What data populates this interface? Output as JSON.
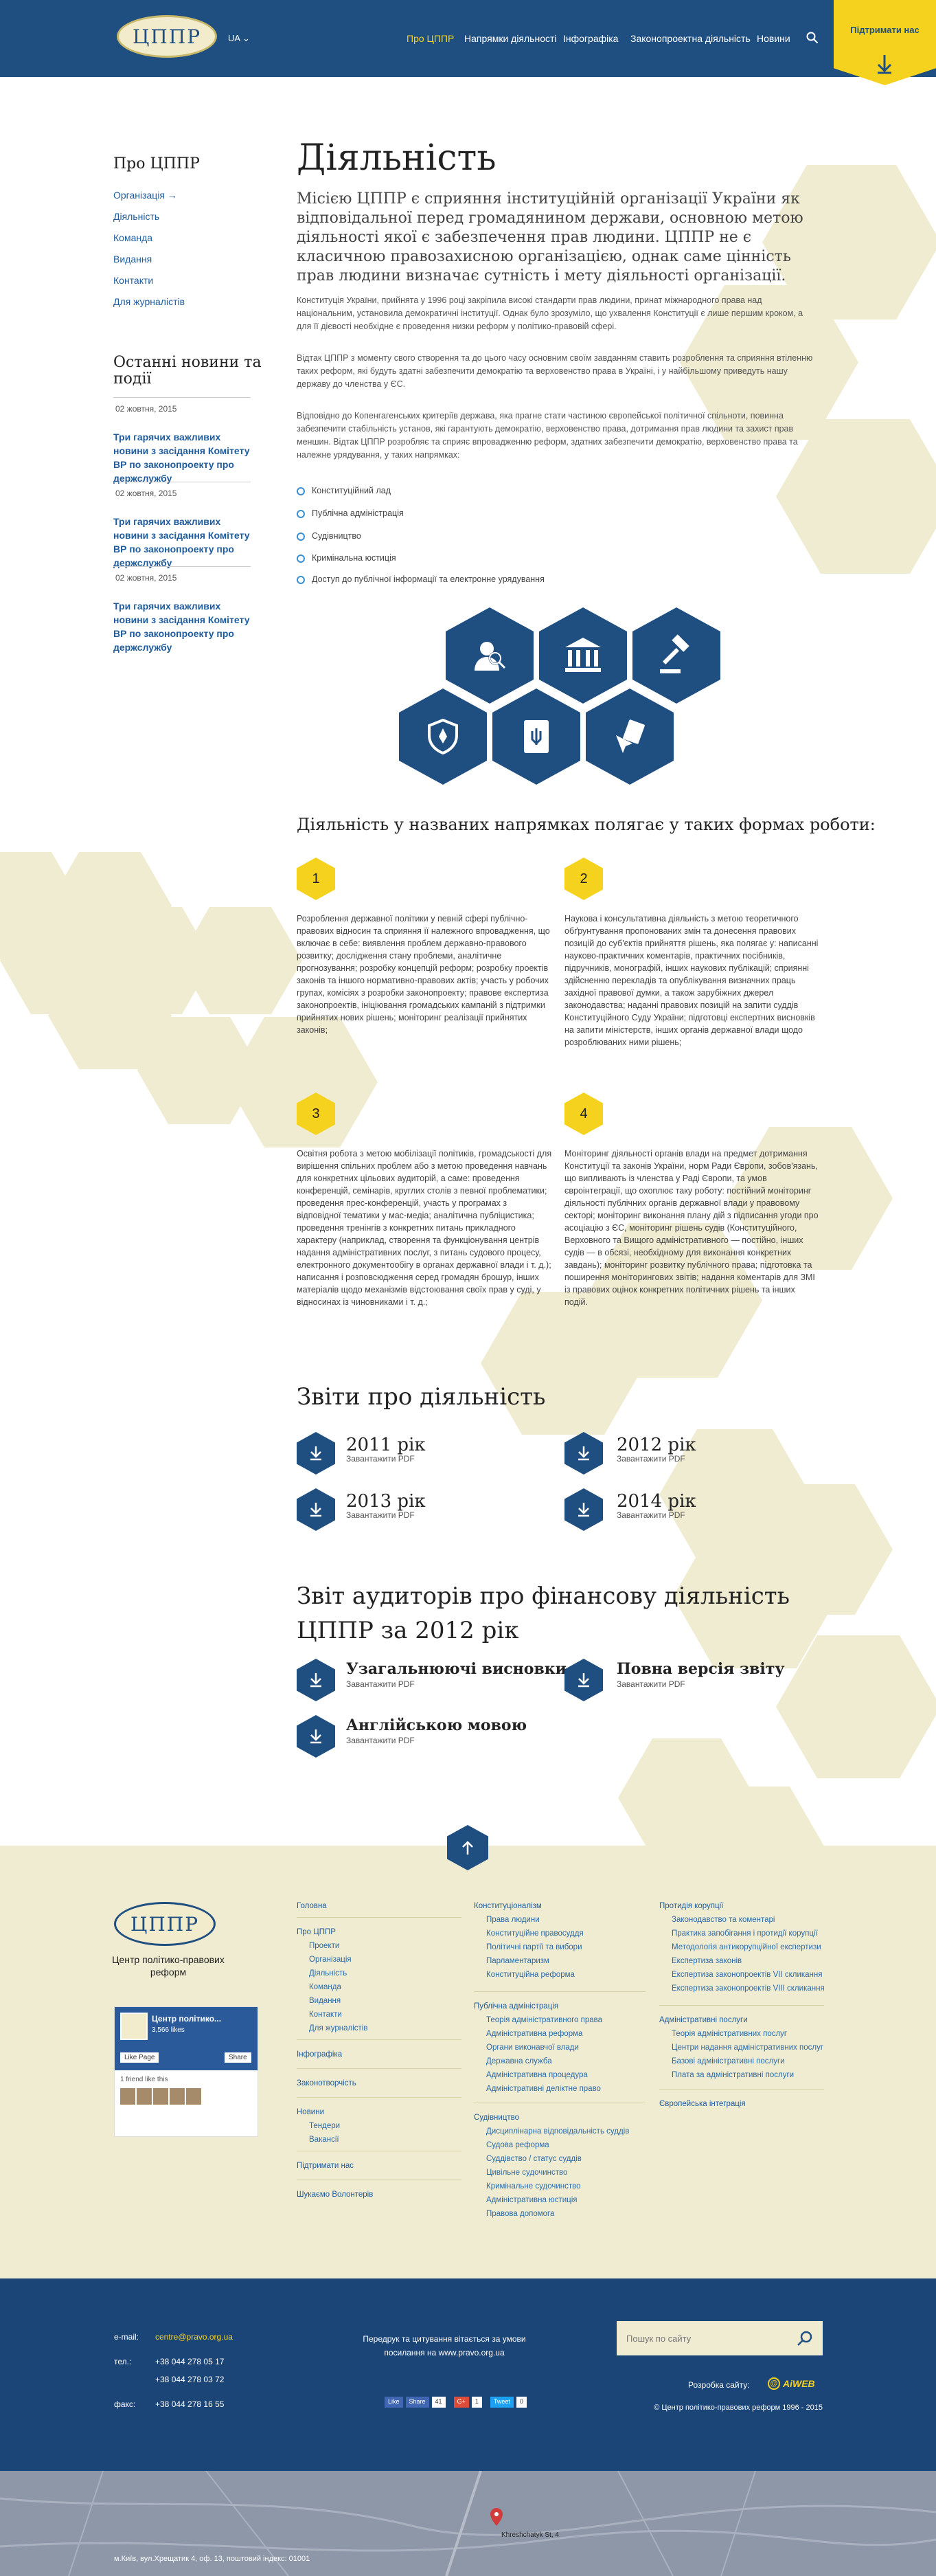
{
  "header": {
    "logo": "ЦППР",
    "lang": "UA",
    "nav": [
      "Про ЦППР",
      "Напрямки діяльності",
      "Інфографіка",
      "Законопроектна діяльність",
      "Новини"
    ],
    "support": "Підтримати нас"
  },
  "sidebar": {
    "title": "Про ЦППР",
    "links": [
      "Організація",
      "Діяльність",
      "Команда",
      "Видання",
      "Контакти",
      "Для журналістів"
    ],
    "news_title": "Останні новини та події",
    "news": [
      {
        "date": "02 жовтня, 2015",
        "title": "Три гарячих важливих новини з засідання Комітету ВР по законопроекту про держслужбу"
      },
      {
        "date": "02 жовтня, 2015",
        "title": "Три гарячих важливих новини з засідання Комітету ВР по законопроекту про держслужбу"
      },
      {
        "date": "02 жовтня, 2015",
        "title": "Три гарячих важливих новини з засідання Комітету ВР по законопроекту про держслужбу"
      }
    ]
  },
  "main": {
    "title": "Діяльність",
    "lead": "Місією ЦППР є сприяння інституційній організації України як відповідальної перед громадянином держави, основною метою діяльності якої є забезпечення прав людини. ЦППР не є класичною правозахисною організацією, однак саме цінність прав людини визначає сутність і мету діяльності організації.",
    "p1": "Конституція України, прийнята у 1996 році закріпила високі стандарти прав людини, принат міжнародного права над національним, установила демократичні інституції. Однак було зрозуміло, що ухвалення Конституції є лише першим кроком, а для її дієвості необхідне є проведення низки реформ у політико-правовій сфері.",
    "p2": "Відтак ЦППР з моменту свого створення та до цього часу основним своїм завданням ставить розроблення та сприяння втіленню таких реформ, які будуть здатні забезпечити демократію та верховенство права в Україні, і у найбільшому приведуть нашу державу до членства у ЄС.",
    "p3": "Відповідно до Копенгагенських критеріїв держава, яка прагне стати частиною європейської політичної спільноти, повинна забезпечити стабільність установ, які гарантують демократію, верховенство права, дотримання прав людини та захист прав меншин. Відтак ЦППР розробляє та сприяє впровадженню реформ, здатних забезпечити демократію, верховенство права та належне урядування, у таких напрямках:",
    "list": [
      "Конституційний лад",
      "Публічна адміністрація",
      "Судівництво",
      "Кримінальна юстиція",
      "Доступ до публічної інформації та електронне урядування"
    ],
    "forms_title": "Діяльність у названих напрямках полягає у таких формах роботи:",
    "forms": [
      {
        "num": "1",
        "text": "Розроблення державної політики у певній сфері публічно-правових відносин та сприяння її належного впровадження, що включає в себе: виявлення проблем державно-правового розвитку; дослідження стану проблеми, аналітичне прогнозування; розробку концепцій реформ; розробку проектів законів та іншого нормативно-правових актів; участь у робочих групах, комісіях з розробки законопроекту; правове експертиза законопроектів, ініціювання громадських кампаній з підтримки прийнятих нових рішень; моніторинг реалізації прийнятих законів;"
      },
      {
        "num": "2",
        "text": "Наукова і консультативна діяльність з метою теоретичного обґрунтування пропонованих змін та донесення правових позицій до суб'єктів прийняття рішень, яка полягає у: написанні науково-практичних коментарів, практичних посібників, підручників, монографій, інших наукових публікацій; сприянні здійсненню перекладів та опублікування визначних праць західної правової думки, а також зарубіжних джерел законодавства; наданні правових позицій на запити суддів Конституційного Суду України; підготовці експертних висновків на запити міністерств, інших органів державної влади щодо розроблюваних ними рішень;"
      },
      {
        "num": "3",
        "text": "Освітня робота з метою мобілізації політиків, громадськості для вирішення спільних проблем або з метою проведення навчань для конкретних цільових аудиторій, а саме: проведення конференцій, семінарів, круглих столів з певної проблематики; проведення прес-конференцій, участь у програмах з відповідної тематики у мас-медіа; аналітична публіцистика; проведення тренінгів з конкретних питань прикладного характеру (наприклад, створення та функціонування центрів надання адміністративних послуг, з питань судового процесу, електронного документообігу в органах державної влади і т. д.); написання і розповсюдження серед громадян брошур, інших матеріалів щодо механізмів відстоювання своїх прав у суді, у відносинах із чиновниками і т. д.;"
      },
      {
        "num": "4",
        "text": "Моніторинг діяльності органів влади на предмет дотримання Конституції та законів України, норм Ради Європи, зобов'язань, що випливають із членства у Раді Європи, та умов євроінтеграції, що охоплює таку роботу: постійний моніторинг діяльності публічних органів державної влади у правовому секторі; моніторинг виконання плану дій з підписання угоди про асоціацію з ЄС, моніторинг рішень судів (Конституційного, Верховного та Вищого адміністративного — постійно, інших судів — в обсязі, необхідному для виконання конкретних завдань); моніторинг розвитку публічного права; підготовка та поширення моніторингових звітів; надання коментарів для ЗМІ із правових оцінок конкретних політичних рішень та інших подій."
      }
    ],
    "reports_title": "Звіти про діяльність",
    "reports": [
      {
        "title": "2011 рік",
        "sub": "Завантажити PDF"
      },
      {
        "title": "2012 рік",
        "sub": "Завантажити PDF"
      },
      {
        "title": "2013 рік",
        "sub": "Завантажити PDF"
      },
      {
        "title": "2014 рік",
        "sub": "Завантажити PDF"
      }
    ],
    "audit_title": "Звіт аудиторів про фінансову діяльність ЦППР за 2012 рік",
    "audit": [
      {
        "title": "Узагальнюючі висновки",
        "sub": "Завантажити PDF"
      },
      {
        "title": "Повна версія звіту",
        "sub": "Завантажити PDF"
      },
      {
        "title": "Англійською мовою",
        "sub": "Завантажити PDF"
      }
    ]
  },
  "footer": {
    "logo": "ЦППР",
    "org": "Центр політико-правових реформ",
    "fb": {
      "name": "Центр політико...",
      "likes": "3,566 likes",
      "like": "Like Page",
      "share": "Share",
      "friends": "1 friend like this"
    },
    "col1": {
      "home": "Головна",
      "about": "Про ЦППР",
      "about_items": [
        "Проекти",
        "Організація",
        "Діяльність",
        "Команда",
        "Видання",
        "Контакти",
        "Для журналістів"
      ],
      "infographics": "Інфографіка",
      "law": "Законотворчість",
      "news": "Новини",
      "news_items": [
        "Тендери",
        "Вакансії"
      ],
      "support": "Підтримати нас",
      "volunteers": "Шукаємо Волонтерів"
    },
    "col2": {
      "const": "Конституціоналізм",
      "const_items": [
        "Права людини",
        "Конституційне правосуддя",
        "Політичні партії та вибори",
        "Парламентаризм",
        "Конституційна реформа"
      ],
      "admin": "Публічна адміністрація",
      "admin_items": [
        "Теорія адміністративного права",
        "Адміністративна реформа",
        "Органи виконавчої влади",
        "Державна служба",
        "Адміністративна процедура",
        "Адміністративні деліктне право"
      ],
      "courts": "Судівництво",
      "courts_items": [
        "Дисциплінарна відповідальність суддів",
        "Судова реформа",
        "Суддівство / статус суддів",
        "Цивільне судочинство",
        "Кримінальне судочинство",
        "Адміністративна юстиція",
        "Правова допомога"
      ]
    },
    "col3": {
      "anti": "Протидія корупції",
      "anti_items": [
        "Законодавство та коментарі",
        "Практика запобігання і протидії корупції",
        "Методологія антикорупційної експертизи",
        "Експертиза законів",
        "Експертиза законопроектів VII скликання",
        "Експертиза законопроектів VIII скликання"
      ],
      "services": "Адміністративні послуги",
      "services_items": [
        "Теорія адміністративних послуг",
        "Центри надання адміністративних послуг",
        "Базові адміністративні послуги",
        "Плата за адміністративні послуги"
      ],
      "eu": "Європейська інтеграція"
    },
    "contacts": {
      "email_label": "e-mail:",
      "email": "centre@pravo.org.ua",
      "tel_label": "тел.:",
      "tel1": "+38 044 278 05 17",
      "tel2": "+38 044 278 03 72",
      "fax_label": "факс:",
      "fax": "+38 044 278 16 55"
    },
    "reprint": "Передрук та цитування вітається за умови посилання на www.pravo.org.ua",
    "search_placeholder": "Пошук по сайту",
    "dev_label": "Розробка сайту:",
    "dev": "AiWEB",
    "copyright": "© Центр політико-правових реформ 1996 - 2015",
    "social": {
      "like": "Like",
      "share": "Share",
      "like_count": "41",
      "gplus": "G+",
      "gplus_count": "1",
      "tweet": "Tweet",
      "tweet_count": "0"
    },
    "address": "м.Київ, вул.Хрещатик 4, оф. 13, поштовий індекс: 01001",
    "map_label": "Khreshchatyk St, 4"
  }
}
